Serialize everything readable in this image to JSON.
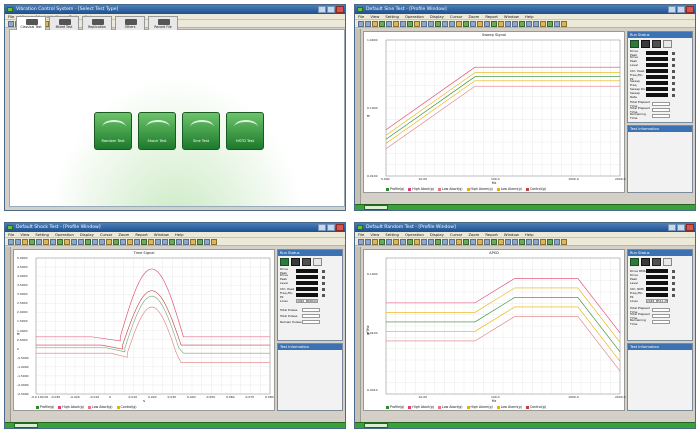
{
  "window1": {
    "title": "Vibration Control System - [Select Test Type]",
    "menu": [
      "File",
      "View",
      "Administration",
      "Tools",
      "Help"
    ],
    "tabs": [
      "Classical Test",
      "Mixed Test",
      "Replication",
      "Others",
      "Record File"
    ],
    "tests": [
      "Random Test",
      "Shock Test",
      "Sine Test",
      "HSTD Test"
    ]
  },
  "window2": {
    "title": "Default Sine Test - [Profile Window]",
    "menu": [
      "File",
      "View",
      "Setting",
      "Operation",
      "Display",
      "Cursor",
      "Zoom",
      "Report",
      "Window",
      "Help"
    ],
    "plot_title": "Sweep Signal",
    "ylabel": "g",
    "xlabel": "Hz",
    "yticks": [
      "1.0000",
      "0.1000",
      "0.0100"
    ],
    "xticks": [
      "5.000",
      "10.00",
      "100.0",
      "1000.0",
      "2000.0"
    ],
    "legend": [
      "Profile(g)",
      "High Abort(g)",
      "Low Abort(g)",
      "High Alarm(g)",
      "Low Alarm(g)",
      "Control(g)"
    ],
    "panel_title": "Run Status",
    "rows": [
      "Drive Peak",
      "Drive Peak",
      "Level",
      "Ctrl. Peak",
      "Freq./Pk-Pk",
      "Sweep Freq.",
      "Sweep Dir.",
      "Sweep Rate"
    ],
    "rows2": [
      "Total Elapsed Time",
      "Total Elapsed Time",
      "Remaining Time"
    ],
    "panel2_title": "Test Information"
  },
  "window3": {
    "title": "Default Shock Test - [Profile Window]",
    "menu": [
      "File",
      "View",
      "Setting",
      "Operation",
      "Display",
      "Cursor",
      "Zoom",
      "Report",
      "Window",
      "Help"
    ],
    "plot_title": "Time Signal",
    "ylabel": "g",
    "xlabel": "s",
    "yticks": [
      "5.0000",
      "4.5000",
      "4.0000",
      "3.5000",
      "3.0000",
      "2.5000",
      "2.0000",
      "1.5000",
      "1.0000",
      "0.5000",
      "0",
      "-0.5000",
      "-1.0000",
      "-1.5000",
      "-2.0000",
      "-2.5000"
    ],
    "xticks": [
      "-0.0 100.00",
      "-0.030",
      "-0.020",
      "-0.010",
      "0",
      "0.010",
      "0.020",
      "0.030",
      "0.040",
      "0.050",
      "0.060",
      "0.070",
      "0.080"
    ],
    "legend": [
      "Profile(g)",
      "High Abort(g)",
      "Low Abort(g)",
      "Control(g)"
    ],
    "panel_title": "Run Status",
    "rows": [
      "Drive Peak",
      "Drive Peak",
      "Level",
      "Ctrl. Peak",
      "Freq./Pk-Pk",
      "Lines"
    ],
    "lines_values": [
      "4096",
      "80000"
    ],
    "rows2": [
      "Total Pulses",
      "Total Pulses",
      "Remain Pulses"
    ],
    "panel2_title": "Test Information"
  },
  "window4": {
    "title": "Default Random Test - [Profile Window]",
    "menu": [
      "File",
      "View",
      "Setting",
      "Operation",
      "Display",
      "Cursor",
      "Zoom",
      "Report",
      "Window",
      "Help"
    ],
    "plot_title": "APSD",
    "ylabel": "g²/Hz",
    "xlabel": "Hz",
    "yticks": [
      "0.1000",
      "0.0100",
      "0.0010"
    ],
    "xticks": [
      "10.00",
      "100.0",
      "1000.0",
      "2000.0"
    ],
    "legend": [
      "Profile(g)",
      "High Abort(g)",
      "Low Abort(g)",
      "High Alarm(g)",
      "Low Alarm(g)",
      "Control(g)"
    ],
    "panel_title": "Run Status",
    "rows": [
      "Drive RMS",
      "Drive Peak",
      "Level",
      "Ctrl. RMS",
      "Freq./Pk-Pk",
      "Lines"
    ],
    "lines_values": [
      "2048",
      "512.25"
    ],
    "rows2": [
      "Total Elapsed Time",
      "Total Elapsed Time",
      "Remaining Time"
    ],
    "panel2_title": "Test Information"
  },
  "colors": {
    "profile": "#2a8a2a",
    "abort": "#e0406a",
    "alarm": "#e8b000",
    "control": "#c04040",
    "low_abort": "#e07a80"
  }
}
